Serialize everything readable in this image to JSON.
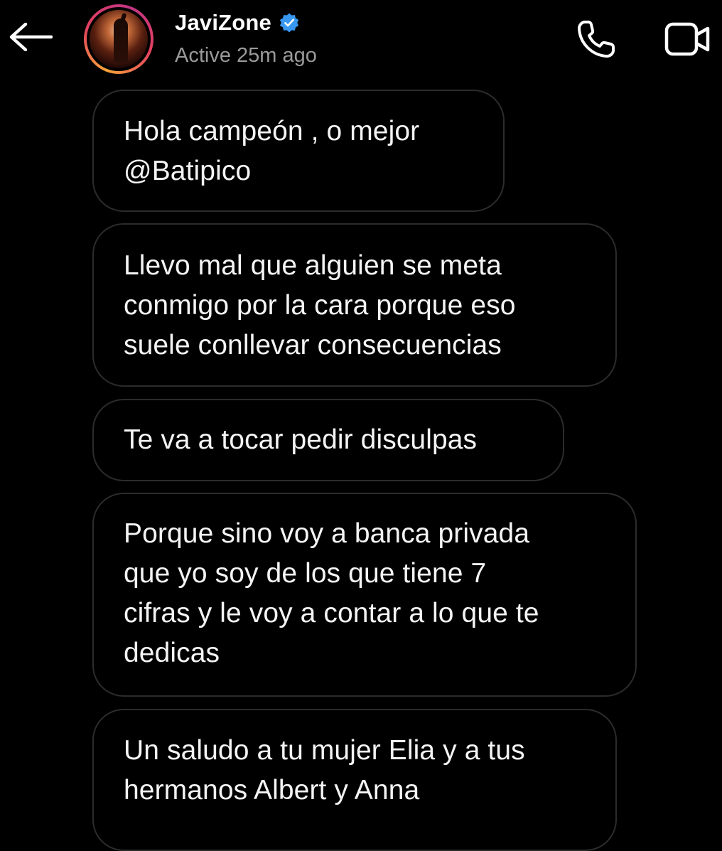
{
  "header": {
    "back_icon": "arrow-left-icon",
    "username": "JaviZone",
    "verified_icon": "verified-badge-icon",
    "status": "Active 25m ago",
    "call_icon": "phone-icon",
    "video_icon": "video-camera-icon",
    "verified_color": "#3897f0"
  },
  "messages": [
    {
      "text": "Hola campeón , o mejor\n@Batipico"
    },
    {
      "text": "Llevo mal que alguien se meta\nconmigo por la cara porque eso\nsuele conllevar consecuencias"
    },
    {
      "text": "Te va a tocar pedir disculpas"
    },
    {
      "text": "Porque sino voy a banca privada\nque yo soy de los que tiene 7\ncifras y le voy a contar a lo que te\ndedicas"
    },
    {
      "text": "Un saludo a tu mujer Elia y a tus\nhermanos Albert y Anna"
    }
  ],
  "colors": {
    "background": "#000000",
    "bubble_border": "#2c2c2c",
    "status_text": "#9a9a9a"
  }
}
